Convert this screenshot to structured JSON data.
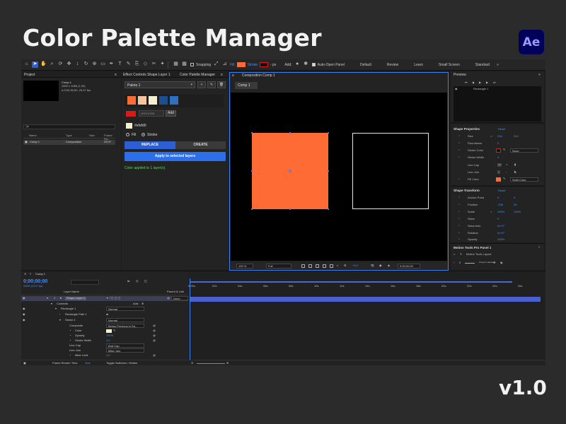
{
  "hero": {
    "title": "Color Palette Manager",
    "logo": "Ae",
    "version": "v1.0"
  },
  "toolbar": {
    "snapping": "Snapping",
    "fill": "Fill",
    "stroke": "Stroke",
    "stroke_unit": "- px",
    "add": "Add:",
    "auto_open": "Auto-Open Panel",
    "workspaces": [
      "Default",
      "Review",
      "Learn",
      "Small Screen",
      "Standard"
    ],
    "fill_color": "#ff6b35",
    "stroke_color": "#d81a1a"
  },
  "project": {
    "tab": "Project",
    "comp_name": "Comp 1",
    "comp_size": "1920 x 1080 (1,00)",
    "comp_duration": "Δ 0;00;30;00, 29,97 fps",
    "search_placeholder": "Q▸",
    "columns": [
      "Name",
      "Type",
      "Size",
      "Frame Ra..."
    ],
    "rows": [
      {
        "name": "Comp 1",
        "type": "Composition",
        "fps": "29,97"
      }
    ],
    "bpc": "8 bpc"
  },
  "palette": {
    "tab_effect": "Effect Controls Shape Layer 1",
    "tab_manager": "Color Palette Manager",
    "selected_palette": "Paleta 1",
    "swatches": [
      "#ff6b35",
      "#f5c49a",
      "#f5f0d0",
      "#1d4f8c",
      "#2e6fbf"
    ],
    "new_color": "#d81a1a",
    "hex_placeholder": "#RRGGBB",
    "add_label": "Add",
    "current_hex": "#efefd0",
    "current_color": "#f5f0d0",
    "radio_fill": "Fill",
    "radio_stroke": "Stroke",
    "replace": "REPLACE",
    "create": "CREATE",
    "apply": "Apply to selected layers",
    "status": "Color applied to 1 layer(s)."
  },
  "composition": {
    "tab": "Composition Comp 1",
    "comp_button": "Comp 1",
    "zoom": "100 %",
    "resolution": "Full",
    "exposure": "+0,0",
    "timecode": "0;00;00;00",
    "shape_fill": "#ff6b35"
  },
  "preview": {
    "tab": "Preview",
    "layer": "Rectangle 1"
  },
  "shape_properties": {
    "title": "Shape Properties",
    "reset": "Reset",
    "size_label": "Size",
    "size": [
      "244",
      "244"
    ],
    "roundness_label": "Roundness",
    "roundness": "0",
    "stroke_color_label": "Stroke Color",
    "stroke_mode": "None",
    "stroke_width_label": "Stroke Width",
    "stroke_width": "2",
    "line_cap_label": "Line Cap",
    "line_join_label": "Line Join",
    "fill_color_label": "Fill Color",
    "fill_mode": "Solid Color",
    "fill_color": "#ff6b35"
  },
  "shape_transform": {
    "title": "Shape Transform",
    "reset": "Reset",
    "anchor_label": "Anchor Point",
    "anchor": [
      "0",
      "0"
    ],
    "position_label": "Position",
    "position": [
      "-236",
      "25"
    ],
    "scale_label": "Scale",
    "scale": [
      "100%",
      "100%"
    ],
    "skew_label": "Skew",
    "skew": "0",
    "skew_axis_label": "Skew Axis",
    "skew_axis": "0x+0°",
    "rotation_label": "Rotation",
    "rotation": "0x+0°",
    "opacity_label": "Opacity",
    "opacity": "100%"
  },
  "motion_tools": {
    "tab": "Motion Tools Pro Panel 1",
    "item": "Motion Tools Layout",
    "value": "0",
    "hint": "0 layers selected"
  },
  "timeline": {
    "tab": "Comp 1",
    "time": "0;00;00;00",
    "time_sub": "00000 (29.97 fps)",
    "col_layer": "Layer Name",
    "col_parent": "Parent & Link",
    "layer_num": "1",
    "layer_name": "Shape Layer 1",
    "parent": "None",
    "contents": "Contents",
    "add": "Add:",
    "rect1": "Rectangle 1",
    "rect1_mode": "Normal",
    "rect_path": "Rectangle Path 1",
    "stroke1": "Stroke 1",
    "stroke1_mode": "Normal",
    "composite": "Composite",
    "composite_val": "Below Previous in Sa...",
    "color": "Color",
    "opacity": "Opacity",
    "opacity_val": "100%",
    "stroke_width": "Stroke Width",
    "stroke_width_val": "2,0",
    "line_cap": "Line Cap",
    "line_cap_val": "Butt Cap",
    "line_join": "Line Join",
    "line_join_val": "Miter Join",
    "miter_limit": "Miter Limit",
    "miter_limit_val": "4,0",
    "ruler": [
      "0:00s",
      "02s",
      "04s",
      "06s",
      "08s",
      "10s",
      "12s",
      "14s",
      "16s",
      "18s",
      "20s",
      "22s",
      "24s",
      "26s"
    ],
    "frame_render": "Frame Render Time",
    "frame_render_val": "1ms",
    "toggle": "Toggle Switches / Modes"
  }
}
